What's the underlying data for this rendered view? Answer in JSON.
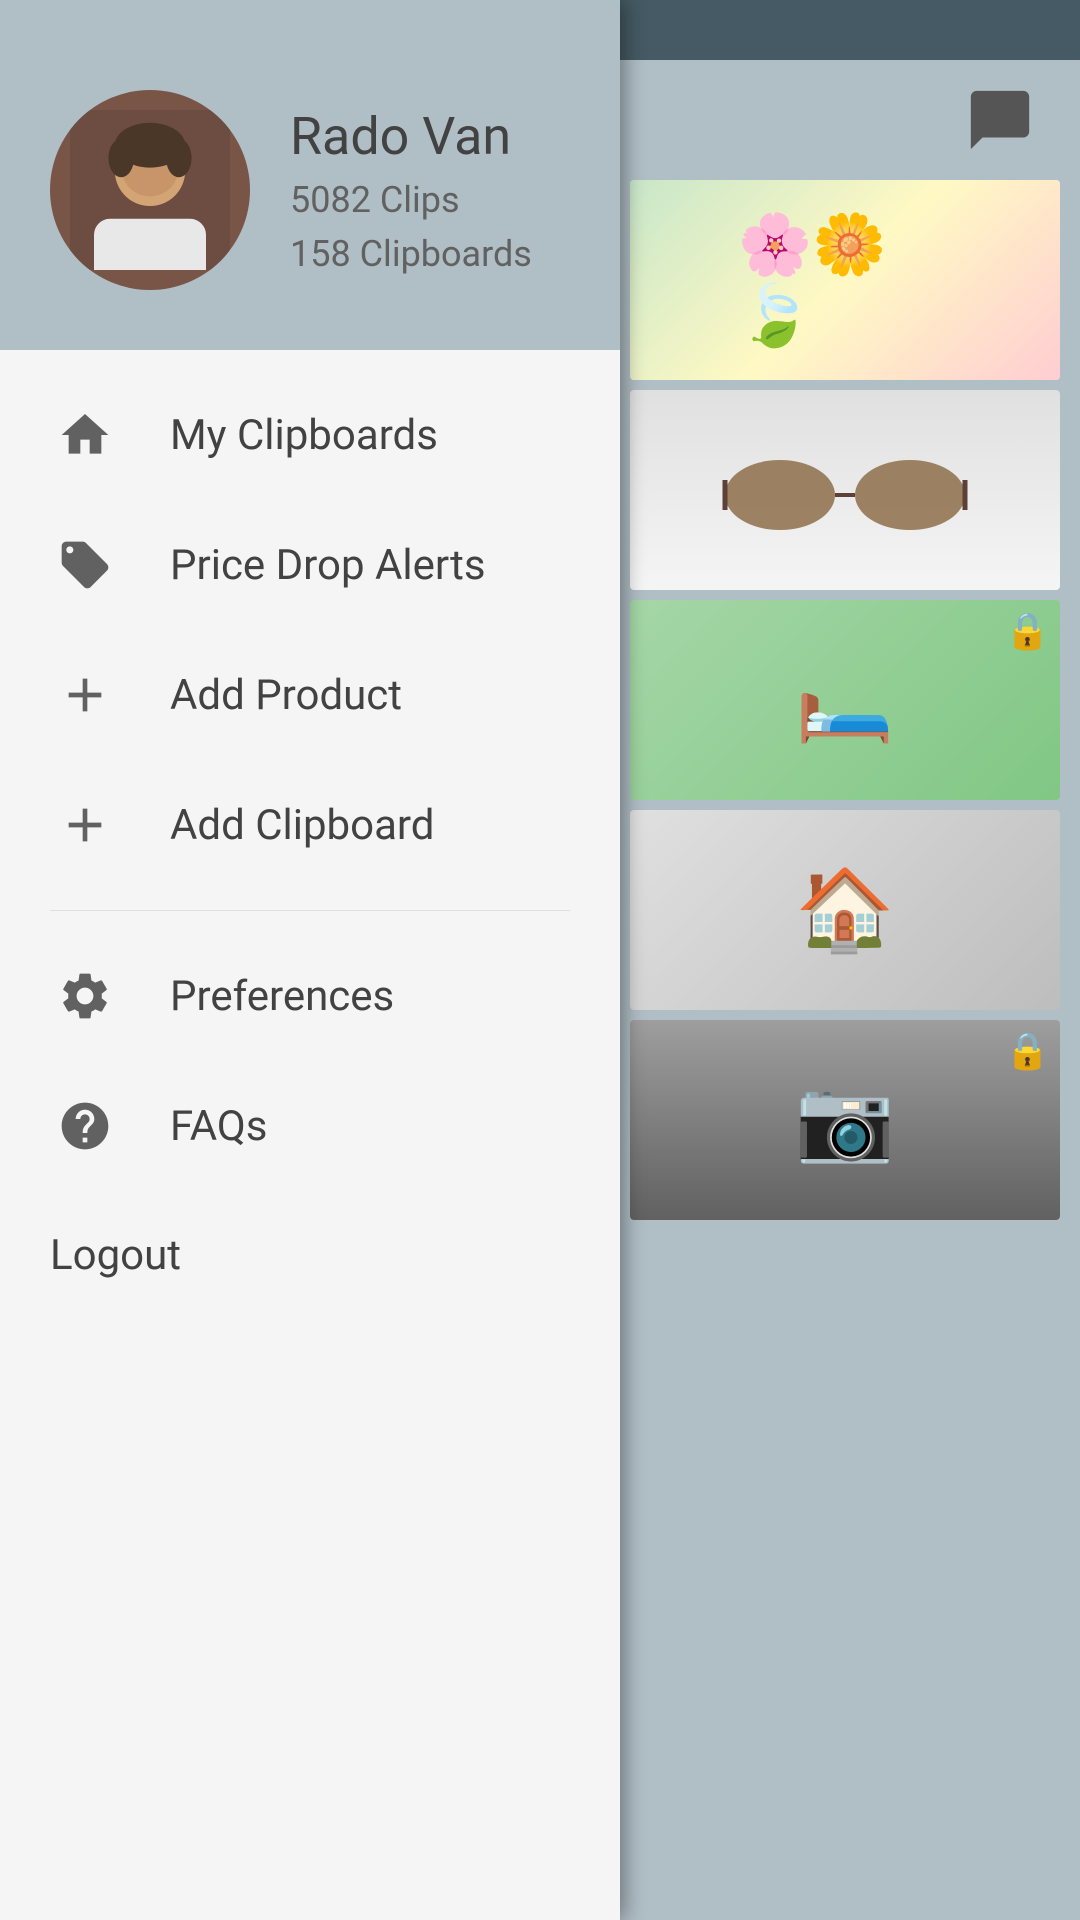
{
  "status_bar": {},
  "right_panel": {
    "chat_icon": "💬"
  },
  "drawer": {
    "header": {
      "user_name": "Rado Van",
      "clips_count": "5082 Clips",
      "clipboards_count": "158 Clipboards",
      "avatar_emoji": "👤"
    },
    "menu": {
      "section1": [
        {
          "id": "my-clipboards",
          "label": "My Clipboards",
          "icon": "home"
        },
        {
          "id": "price-drop-alerts",
          "label": "Price Drop Alerts",
          "icon": "price-tag"
        },
        {
          "id": "add-product",
          "label": "Add Product",
          "icon": "plus"
        },
        {
          "id": "add-clipboard",
          "label": "Add Clipboard",
          "icon": "plus"
        }
      ],
      "section2": [
        {
          "id": "preferences",
          "label": "Preferences",
          "icon": "gear"
        },
        {
          "id": "faqs",
          "label": "FAQs",
          "icon": "question"
        }
      ],
      "logout_label": "Logout"
    }
  },
  "images": [
    {
      "type": "flower",
      "locked": false
    },
    {
      "type": "sunglasses",
      "locked": false
    },
    {
      "type": "bed1",
      "locked": true
    },
    {
      "type": "bed2",
      "locked": false
    },
    {
      "type": "camera",
      "locked": true
    }
  ]
}
